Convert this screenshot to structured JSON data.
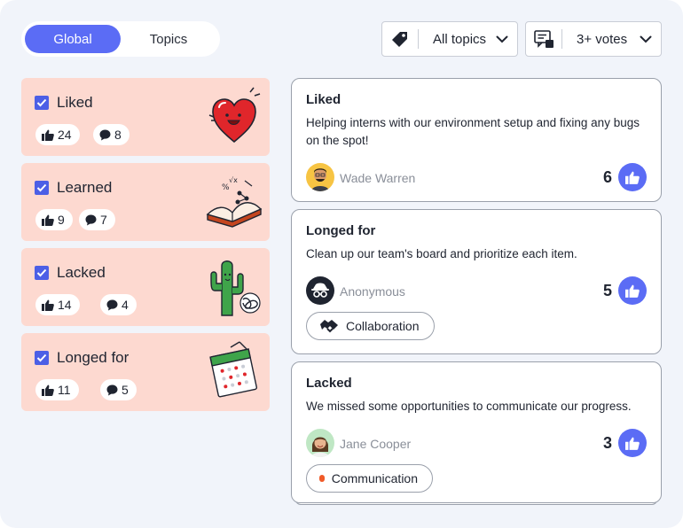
{
  "toggle": {
    "global": "Global",
    "topics": "Topics",
    "active": "Global"
  },
  "filters": {
    "topics": {
      "icon": "tag-icon",
      "label": "All topics"
    },
    "votes": {
      "icon": "votes-filter-icon",
      "label": "3+ votes"
    }
  },
  "categories": [
    {
      "name": "Liked",
      "likes": "24",
      "comments": "8",
      "checked": true,
      "art": "heart-illustration"
    },
    {
      "name": "Learned",
      "likes": "9",
      "comments": "7",
      "checked": true,
      "art": "book-illustration"
    },
    {
      "name": "Lacked",
      "likes": "14",
      "comments": "4",
      "checked": true,
      "art": "cactus-illustration"
    },
    {
      "name": "Longed for",
      "likes": "11",
      "comments": "5",
      "checked": true,
      "art": "calendar-illustration"
    }
  ],
  "cards": [
    {
      "category": "Liked",
      "text": "Helping interns with our environment setup and fixing any bugs on the spot!",
      "author": "Wade Warren",
      "votes": "6",
      "tag": null
    },
    {
      "category": "Longed for",
      "text": "Clean up our team's board and prioritize each item.",
      "author": "Anonymous",
      "votes": "5",
      "tag": "Collaboration"
    },
    {
      "category": "Lacked",
      "text": "We missed some opportunities to communicate our progress.",
      "author": "Jane Cooper",
      "votes": "3",
      "tag": "Communication"
    }
  ],
  "colors": {
    "accent": "#5b6cf5",
    "category_bg": "#fdd9d0",
    "checkbox": "#4c5fe6",
    "communication_dot": "#f05a28",
    "page_bg": "#f1f4fa"
  }
}
